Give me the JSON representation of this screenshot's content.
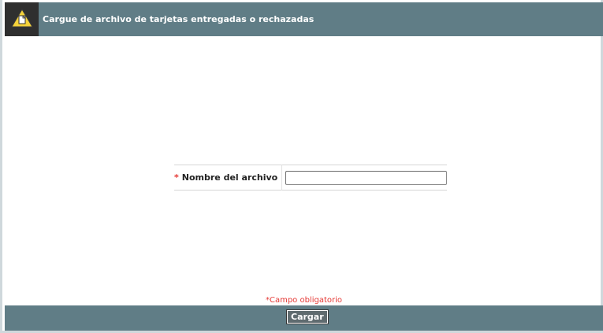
{
  "header": {
    "icon": "warning-document-icon",
    "title": "Cargue de archivo de tarjetas entregadas o rechazadas"
  },
  "form": {
    "required_marker": "*",
    "file_label": "Nombre del archivo",
    "file_value": ""
  },
  "footer": {
    "required_note": "*Campo obligatorio",
    "submit_label": "Cargar"
  },
  "colors": {
    "header_bg": "#607d86",
    "icon_bg": "#2f2f2f",
    "warning_yellow": "#f5d23a",
    "required_red": "#e53935"
  }
}
